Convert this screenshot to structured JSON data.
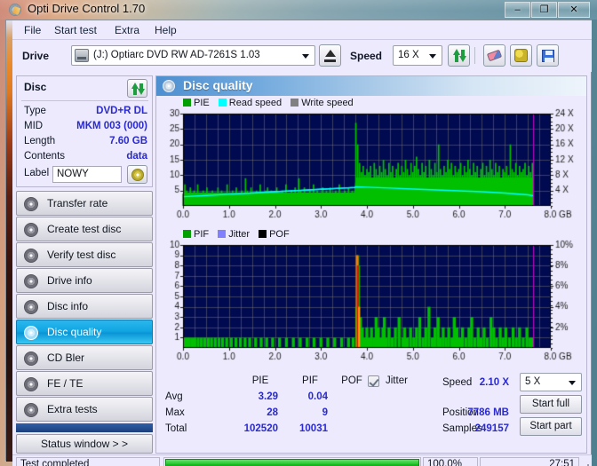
{
  "window": {
    "title": "Opti Drive Control 1.70",
    "title_icon": "disc-icon",
    "controls": {
      "minimize": "–",
      "maximize": "❐",
      "close": "✕"
    }
  },
  "menu": {
    "items": [
      "File",
      "Start test",
      "Extra",
      "Help"
    ]
  },
  "toolbar": {
    "drive_label": "Drive",
    "drive_value": "(J:)  Optiarc DVD RW AD-7261S 1.03",
    "eject_icon": "eject-icon",
    "speed_label": "Speed",
    "speed_value": "16 X",
    "refresh_icon": "refresh-arrows-icon",
    "erase_icon": "eraser-icon",
    "settings_icon": "tools-icon",
    "save_icon": "save-floppy-icon"
  },
  "disc": {
    "title": "Disc",
    "refresh_icon": "refresh-arrows-icon",
    "rows": [
      {
        "key": "Type",
        "value": "DVD+R DL"
      },
      {
        "key": "MID",
        "value": "MKM 003 (000)"
      },
      {
        "key": "Length",
        "value": "7.60 GB"
      },
      {
        "key": "Contents",
        "value": "data"
      }
    ],
    "label_key": "Label",
    "label_value": "NOWY",
    "label_placeholder": "",
    "label_button_icon": "disc-label-icon"
  },
  "sidebar": {
    "items": [
      {
        "label": "Transfer rate",
        "icon": "disc-transfer-icon",
        "selected": false
      },
      {
        "label": "Create test disc",
        "icon": "disc-create-icon",
        "selected": false
      },
      {
        "label": "Verify test disc",
        "icon": "disc-verify-icon",
        "selected": false
      },
      {
        "label": "Drive info",
        "icon": "drive-info-icon",
        "selected": false
      },
      {
        "label": "Disc info",
        "icon": "disc-info-icon",
        "selected": false
      },
      {
        "label": "Disc quality",
        "icon": "disc-quality-icon",
        "selected": true
      },
      {
        "label": "CD Bler",
        "icon": "disc-bler-icon",
        "selected": false
      },
      {
        "label": "FE / TE",
        "icon": "disc-fete-icon",
        "selected": false
      },
      {
        "label": "Extra tests",
        "icon": "disc-extra-icon",
        "selected": false
      }
    ],
    "status_window_label": "Status window > >"
  },
  "content": {
    "header_title": "Disc quality",
    "header_icon": "disc-quality-icon"
  },
  "results": {
    "col_headers": [
      "PIE",
      "PIF",
      "POF"
    ],
    "row_headers": [
      "Avg",
      "Max",
      "Total"
    ],
    "pie": {
      "avg": "3.29",
      "max": "28",
      "total": "102520"
    },
    "pif": {
      "avg": "0.04",
      "max": "9",
      "total": "10031"
    },
    "pof": {
      "avg": "",
      "max": "",
      "total": ""
    },
    "jitter_label": "Jitter",
    "jitter_checked": true,
    "speed_label": "Speed",
    "speed_value": "2.10 X",
    "position_label": "Position",
    "position_value": "7786 MB",
    "samples_label": "Samples",
    "samples_value": "249157",
    "test_speed_value": "5 X",
    "start_full_label": "Start full",
    "start_part_label": "Start part"
  },
  "statusbar": {
    "status_text": "Test completed",
    "percent": "100.0%",
    "progress_value": 100,
    "elapsed": "27:51"
  },
  "colors": {
    "pie_green": "#00c000",
    "read_speed_cyan": "#00ffff",
    "write_speed_gray": "#808080",
    "pif_green": "#00c000",
    "jitter_purple": "#8080ff",
    "pof_black": "#000000",
    "plot_bg": "#000a50",
    "marker_magenta": "#c800c8",
    "accent_blue": "#2a2ad0",
    "selection_cyan": "#12a6e2"
  },
  "chart_data": [
    {
      "type": "area",
      "id": "pie-chart",
      "title": "",
      "xlabel": "GB",
      "ylabel": "PIE",
      "xlim": [
        0.0,
        8.0
      ],
      "ylim": [
        0,
        30
      ],
      "y2lim": [
        0,
        24
      ],
      "y2label": "X",
      "xticks": [
        "0.0",
        "1.0",
        "2.0",
        "3.0",
        "4.0",
        "5.0",
        "6.0",
        "7.0",
        "8.0 GB"
      ],
      "yticks": [
        5,
        10,
        15,
        20,
        25,
        30
      ],
      "y2ticks": [
        "4 X",
        "8 X",
        "12 X",
        "16 X",
        "20 X",
        "24 X"
      ],
      "grid": true,
      "legend": [
        {
          "name": "PIE",
          "color": "#00c000"
        },
        {
          "name": "Read speed",
          "color": "#00ffff"
        },
        {
          "name": "Write speed",
          "color": "#808080"
        }
      ],
      "end_marker_x": 7.62,
      "layer_break_x": 3.75,
      "series": [
        {
          "name": "PIE",
          "color": "#00c000",
          "x": [
            0.0,
            0.04,
            0.08,
            0.12,
            0.16,
            0.2,
            0.24,
            0.28,
            0.32,
            0.36,
            0.4,
            0.44,
            0.48,
            0.52,
            0.56,
            0.6,
            0.64,
            0.68,
            0.72,
            0.76,
            0.8,
            0.84,
            0.88,
            0.92,
            0.96,
            1.0,
            1.04,
            1.08,
            1.12,
            1.16,
            1.2,
            1.24,
            1.28,
            1.32,
            1.36,
            1.4,
            1.44,
            1.48,
            1.52,
            1.56,
            1.6,
            1.64,
            1.68,
            1.72,
            1.76,
            1.8,
            1.84,
            1.88,
            1.92,
            1.96,
            2.0,
            2.04,
            2.08,
            2.12,
            2.16,
            2.2,
            2.24,
            2.28,
            2.32,
            2.36,
            2.4,
            2.44,
            2.48,
            2.52,
            2.56,
            2.6,
            2.64,
            2.68,
            2.72,
            2.76,
            2.8,
            2.84,
            2.88,
            2.92,
            2.96,
            3.0,
            3.04,
            3.08,
            3.12,
            3.16,
            3.2,
            3.24,
            3.28,
            3.32,
            3.36,
            3.4,
            3.44,
            3.48,
            3.52,
            3.56,
            3.6,
            3.64,
            3.68,
            3.72,
            3.76,
            3.8,
            3.84,
            3.88,
            3.92,
            3.96,
            4.0,
            4.04,
            4.08,
            4.12,
            4.16,
            4.2,
            4.24,
            4.28,
            4.32,
            4.36,
            4.4,
            4.44,
            4.48,
            4.52,
            4.56,
            4.6,
            4.64,
            4.68,
            4.72,
            4.76,
            4.8,
            4.84,
            4.88,
            4.92,
            4.96,
            5.0,
            5.04,
            5.08,
            5.12,
            5.16,
            5.2,
            5.24,
            5.28,
            5.32,
            5.36,
            5.4,
            5.44,
            5.48,
            5.52,
            5.56,
            5.6,
            5.64,
            5.68,
            5.72,
            5.76,
            5.8,
            5.84,
            5.88,
            5.92,
            5.96,
            6.0,
            6.04,
            6.08,
            6.12,
            6.16,
            6.2,
            6.24,
            6.28,
            6.32,
            6.36,
            6.4,
            6.44,
            6.48,
            6.52,
            6.56,
            6.6,
            6.64,
            6.68,
            6.72,
            6.76,
            6.8,
            6.84,
            6.88,
            6.92,
            6.96,
            7.0,
            7.04,
            7.08,
            7.12,
            7.16,
            7.2,
            7.24,
            7.28,
            7.32,
            7.36,
            7.4,
            7.44,
            7.48,
            7.52,
            7.56,
            7.6
          ],
          "values": [
            4,
            7,
            5,
            4,
            6,
            4,
            5,
            4,
            7,
            4,
            4,
            5,
            4,
            6,
            4,
            4,
            5,
            4,
            4,
            6,
            4,
            5,
            4,
            4,
            7,
            4,
            4,
            5,
            4,
            6,
            4,
            4,
            5,
            4,
            9,
            5,
            4,
            6,
            4,
            4,
            5,
            4,
            7,
            4,
            4,
            5,
            6,
            4,
            5,
            4,
            4,
            6,
            4,
            4,
            5,
            4,
            7,
            4,
            4,
            5,
            4,
            6,
            4,
            9,
            5,
            4,
            6,
            4,
            4,
            5,
            4,
            7,
            4,
            5,
            4,
            4,
            6,
            4,
            5,
            4,
            6,
            4,
            4,
            5,
            4,
            7,
            4,
            4,
            5,
            4,
            6,
            4,
            5,
            4,
            27,
            20,
            14,
            11,
            13,
            10,
            12,
            11,
            13,
            9,
            14,
            12,
            10,
            13,
            11,
            15,
            12,
            10,
            14,
            11,
            13,
            9,
            12,
            14,
            10,
            13,
            11,
            15,
            12,
            10,
            14,
            11,
            13,
            16,
            12,
            10,
            14,
            11,
            13,
            9,
            15,
            12,
            10,
            14,
            11,
            20,
            12,
            10,
            13,
            11,
            15,
            12,
            14,
            10,
            13,
            11,
            12,
            14,
            10,
            13,
            11,
            15,
            12,
            10,
            14,
            11,
            13,
            9,
            12,
            14,
            10,
            13,
            11,
            15,
            12,
            10,
            14,
            11,
            13,
            9,
            12,
            11,
            13,
            10,
            20,
            12,
            11,
            14,
            10,
            13,
            11,
            12,
            14,
            10,
            13,
            11,
            14
          ]
        },
        {
          "name": "Read speed",
          "color": "#00ffff",
          "x": [
            0.0,
            0.5,
            1.0,
            1.5,
            2.0,
            2.5,
            3.0,
            3.5,
            3.74,
            3.76,
            4.0,
            4.5,
            5.0,
            5.5,
            6.0,
            6.5,
            7.0,
            7.5,
            7.62
          ],
          "values": [
            3.0,
            3.4,
            3.8,
            4.2,
            4.6,
            5.0,
            5.4,
            5.8,
            6.0,
            6.2,
            6.1,
            5.8,
            5.5,
            5.2,
            4.9,
            4.6,
            4.2,
            3.6,
            3.3
          ]
        },
        {
          "name": "Write speed",
          "color": "#808080",
          "x": [],
          "values": []
        }
      ]
    },
    {
      "type": "bar",
      "id": "pif-chart",
      "title": "",
      "xlabel": "GB",
      "ylabel": "PIF",
      "xlim": [
        0.0,
        8.0
      ],
      "ylim": [
        0,
        10
      ],
      "y2lim": [
        0,
        10
      ],
      "y2label": "%",
      "xticks": [
        "0.0",
        "1.0",
        "2.0",
        "3.0",
        "4.0",
        "5.0",
        "6.0",
        "7.0",
        "8.0 GB"
      ],
      "yticks": [
        1,
        2,
        3,
        4,
        5,
        6,
        7,
        8,
        9,
        10
      ],
      "y2ticks": [
        "2%",
        "4%",
        "6%",
        "8%",
        "10%"
      ],
      "grid": true,
      "legend": [
        {
          "name": "PIF",
          "color": "#00c000"
        },
        {
          "name": "Jitter",
          "color": "#8080ff"
        },
        {
          "name": "POF",
          "color": "#000000"
        }
      ],
      "end_marker_x": 7.62,
      "layer_break_x": 3.78,
      "series": [
        {
          "name": "PIF",
          "color": "#00c000",
          "x": [
            0.05,
            0.1,
            0.14,
            0.2,
            0.26,
            0.33,
            0.4,
            0.47,
            0.55,
            0.62,
            0.7,
            0.78,
            0.86,
            0.95,
            1.05,
            1.15,
            1.25,
            1.35,
            1.45,
            1.58,
            1.7,
            1.82,
            1.95,
            2.1,
            2.25,
            2.4,
            2.55,
            2.7,
            2.85,
            3.0,
            3.15,
            3.3,
            3.45,
            3.6,
            3.7,
            3.78,
            3.8,
            3.82,
            3.86,
            3.9,
            3.95,
            4.0,
            4.05,
            4.1,
            4.15,
            4.2,
            4.25,
            4.3,
            4.35,
            4.38,
            4.42,
            4.48,
            4.55,
            4.62,
            4.7,
            4.78,
            4.82,
            4.88,
            4.95,
            5.02,
            5.08,
            5.15,
            5.22,
            5.28,
            5.35,
            5.42,
            5.48,
            5.55,
            5.6,
            5.66,
            5.72,
            5.78,
            5.85,
            5.9,
            5.96,
            6.02,
            6.08,
            6.15,
            6.22,
            6.28,
            6.35,
            6.42,
            6.48,
            6.55,
            6.62,
            6.7,
            6.76,
            6.82,
            6.9,
            6.96,
            7.02,
            7.1,
            7.18,
            7.25,
            7.32,
            7.4,
            7.48,
            7.55,
            7.6
          ],
          "values": [
            1,
            1,
            1,
            1,
            1,
            1,
            1,
            1,
            1,
            1,
            1,
            1,
            1,
            1,
            1,
            1,
            1,
            1,
            1,
            1,
            1,
            1,
            1,
            1,
            1,
            1,
            1,
            1,
            1,
            1,
            1,
            1,
            1,
            1,
            1,
            4,
            9,
            8,
            3,
            2,
            1,
            2,
            1,
            2,
            1,
            3,
            2,
            1,
            2,
            3,
            1,
            2,
            1,
            2,
            3,
            1,
            2,
            1,
            2,
            1,
            2,
            3,
            1,
            2,
            4,
            1,
            2,
            3,
            1,
            2,
            1,
            2,
            1,
            3,
            2,
            1,
            2,
            1,
            2,
            3,
            1,
            2,
            1,
            2,
            1,
            3,
            2,
            1,
            2,
            1,
            2,
            1,
            2,
            1,
            2,
            1,
            2,
            1,
            1
          ]
        },
        {
          "name": "POF",
          "color": "#000000",
          "x": [],
          "values": []
        }
      ],
      "spike_note": "Tall orange/red PIF spike at layer break near 3.78-3.82 GB reaching 9"
    }
  ]
}
